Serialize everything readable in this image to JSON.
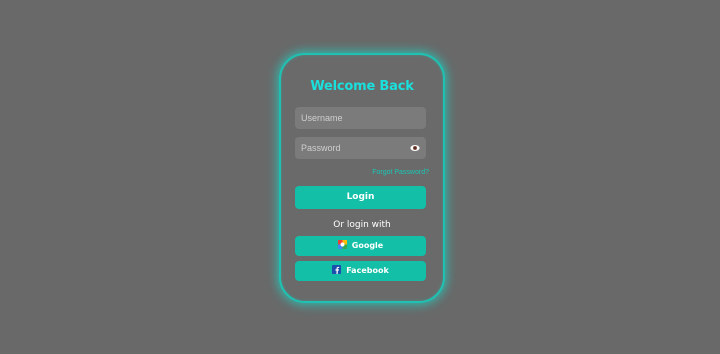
{
  "login_card": {
    "title": "Welcome Back",
    "username_placeholder": "Username",
    "password_placeholder": "Password",
    "forgot_password_label": "Forgot Password?",
    "login_button_label": "Login",
    "social_prompt": "Or login with",
    "google_button_label": "Google",
    "facebook_button_label": "Facebook"
  },
  "icons": {
    "password_toggle": "eye-icon",
    "google": "google-icon",
    "facebook": "facebook-icon"
  },
  "colors": {
    "background": "#696969",
    "accent_glow": "#1fc2b2",
    "title": "#19e0dc",
    "button": "#14bfa7",
    "input_fill": "#7b7b7b"
  }
}
